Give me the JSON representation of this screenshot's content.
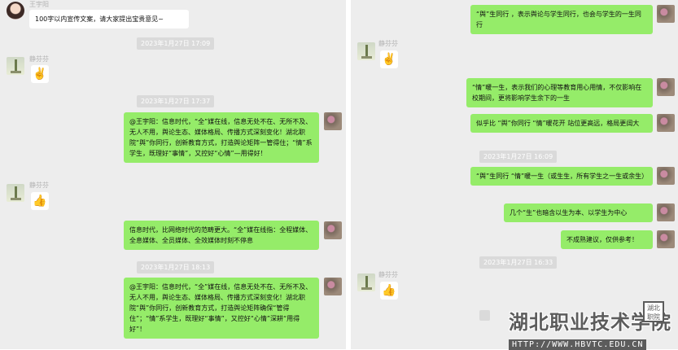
{
  "left_panel": {
    "top_sender_name": "王宇阳",
    "top_message": "100字以内宣传文案，请大家提出宝贵意见~",
    "timestamps": [
      "2023年1月27日 17:09",
      "2023年1月27日 17:37",
      "2023年1月27日 18:13"
    ],
    "sender_name": "静芬芬",
    "messages": [
      "@王宇阳：信息时代，“全”媒在线，信息无处不在、无所不及、无人不用，舆论生态、媒体格局、传播方式深刻变化！湖北职院“舆”你同行，创新教育方式，打造舆论矩阵一管得住；“情”系学生，既理好“事情”，又控好“心情”—用得好！",
      "信息时代，比网络时代的范畴更大。“全”媒在线指：全程媒体、全息媒体、全员媒体、全效媒体时刻不停息",
      "@王宇阳：信息时代，“全”媒在线，信息无处不在、无所不及、无人不用，舆论生态、媒体格局、传播方式深刻变化！湖北职院“舆”你同行，创新教育方式，打造舆论矩阵确保“管得住”；“情”系学生，既理好“事情”，又控好“心情”深耕“用得好”！"
    ]
  },
  "right_panel": {
    "sender_name": "静芬芬",
    "timestamps": [
      "2023年1月27日 16:09",
      "2023年1月27日 16:33"
    ],
    "messages": [
      "“舆”生同行 ，表示舆论与学生同行，也会与学生的一生同行",
      "“情”暖一生，表示我们的心理等教育用心用情，不仅影响在校期间，更将影响学生余下的一生",
      "似乎比 “舆”你同行 “情”暖花开 站位更高远，格局更阔大",
      "“舆”生同行 “情”暖一生（或生生，所有学生之一生或余生）",
      "几个“生”也暗含以生为本、以学生为中心",
      "不成熟建议，仅供参考！"
    ]
  },
  "icons": {
    "ok_hand": "✌️",
    "thumbs_up": "👍",
    "victory": "✌️"
  },
  "watermark": {
    "name": "湖北职业技术学院",
    "url": "HTTP://WWW.HBVTC.EDU.CN",
    "seal": "湖北职院"
  },
  "colors": {
    "chat_background": "#ededed",
    "sent_bubble": "#95ec69",
    "received_bubble": "#ffffff",
    "timestamp_bg": "#dadada"
  }
}
